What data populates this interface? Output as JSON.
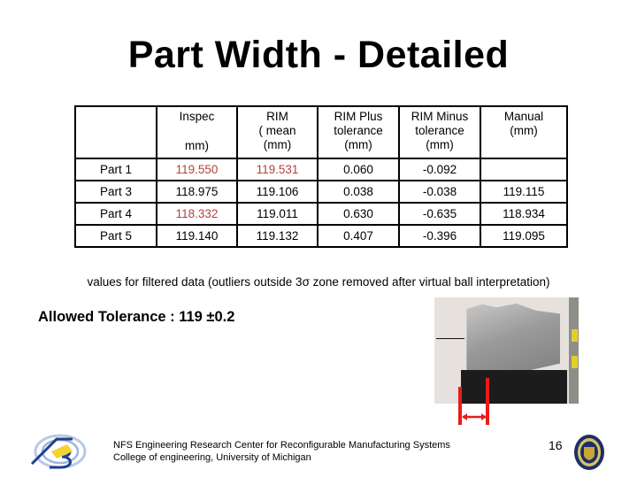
{
  "slide": {
    "title": "Part Width - Detailed",
    "page_number": "16"
  },
  "table": {
    "headers": [
      {
        "lines": [
          "",
          ""
        ]
      },
      {
        "lines": [
          "Inspec",
          "mm)"
        ]
      },
      {
        "lines": [
          "RIM",
          "( mean",
          "(mm)"
        ]
      },
      {
        "lines": [
          "RIM Plus",
          "tolerance",
          "(mm)"
        ]
      },
      {
        "lines": [
          "RIM Minus",
          "tolerance",
          "(mm)"
        ]
      },
      {
        "lines": [
          "Manual",
          "(mm)"
        ]
      }
    ],
    "rows": [
      {
        "part": "Part 1",
        "inspec": "119.550",
        "rim_mean": "119.531",
        "rim_plus": "0.060",
        "rim_minus": "-0.092",
        "manual": ""
      },
      {
        "part": "Part 3",
        "inspec": "118.975",
        "rim_mean": "119.106",
        "rim_plus": "0.038",
        "rim_minus": "-0.038",
        "manual": "119.115"
      },
      {
        "part": "Part 4",
        "inspec": "118.332",
        "rim_mean": "119.011",
        "rim_plus": "0.630",
        "rim_minus": "-0.635",
        "manual": "118.934"
      },
      {
        "part": "Part 5",
        "inspec": "119.140",
        "rim_mean": "119.132",
        "rim_plus": "0.407",
        "rim_minus": "-0.396",
        "manual": "119.095"
      }
    ],
    "highlight_color": "#b5403f"
  },
  "note": "values for filtered data (outliers outside 3σ zone removed after virtual ball interpretation)",
  "tolerance": "Allowed Tolerance : 119 ±0.2",
  "photo": {
    "description": "engine cylinder head on fixture with red width measurement marker",
    "marker_color": "#e81c1c"
  },
  "footer": {
    "line1": "NFS Engineering Research Center for Reconfigurable Manufacturing Systems",
    "line2": "College of engineering, University of Michigan"
  }
}
